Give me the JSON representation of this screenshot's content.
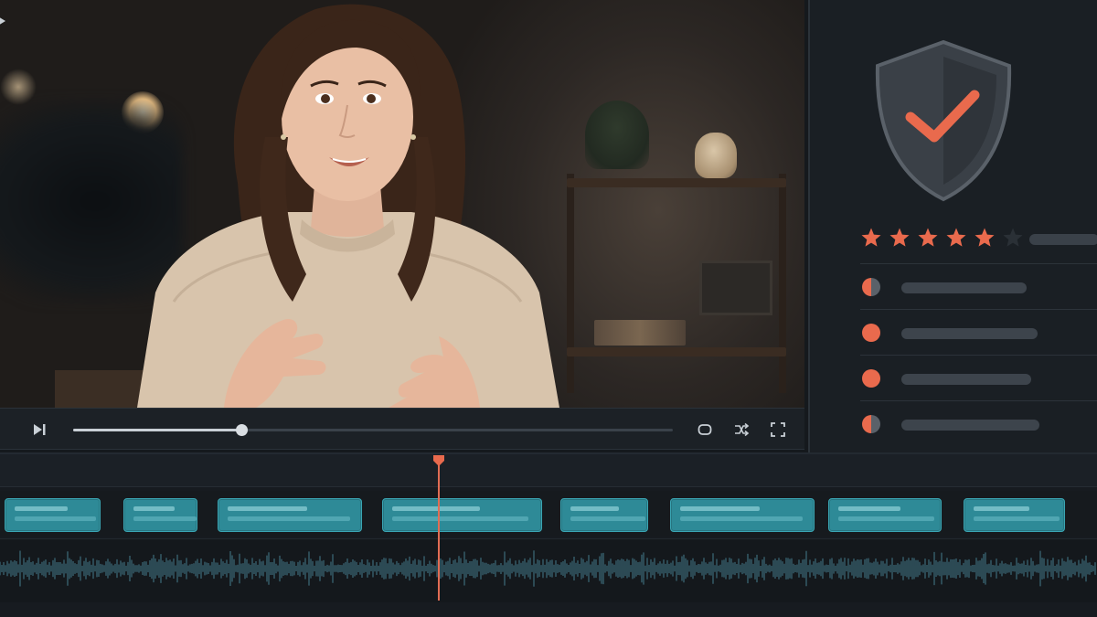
{
  "player": {
    "controls": [
      {
        "name": "play-icon"
      },
      {
        "name": "step-forward-icon"
      },
      {
        "name": "loop-icon"
      },
      {
        "name": "shuffle-icon"
      },
      {
        "name": "fullscreen-icon"
      }
    ],
    "progress": 0.28
  },
  "review_panel": {
    "badge_icon": "shield-check-icon",
    "rating": {
      "filled": 5,
      "max": 6
    },
    "criteria": [
      {
        "status": "partial",
        "fill": 0.45
      },
      {
        "status": "active",
        "fill": 0.7
      },
      {
        "status": "active",
        "fill": 0.55
      },
      {
        "status": "partial",
        "fill": 0.75
      }
    ]
  },
  "timeline": {
    "clip_count": 8,
    "playhead_position": 0.4
  },
  "colors": {
    "accent": "#e96a4d",
    "clip": "#2e8a97",
    "panel_bg": "#1a1f24",
    "waveform": "#3c6b7a"
  }
}
